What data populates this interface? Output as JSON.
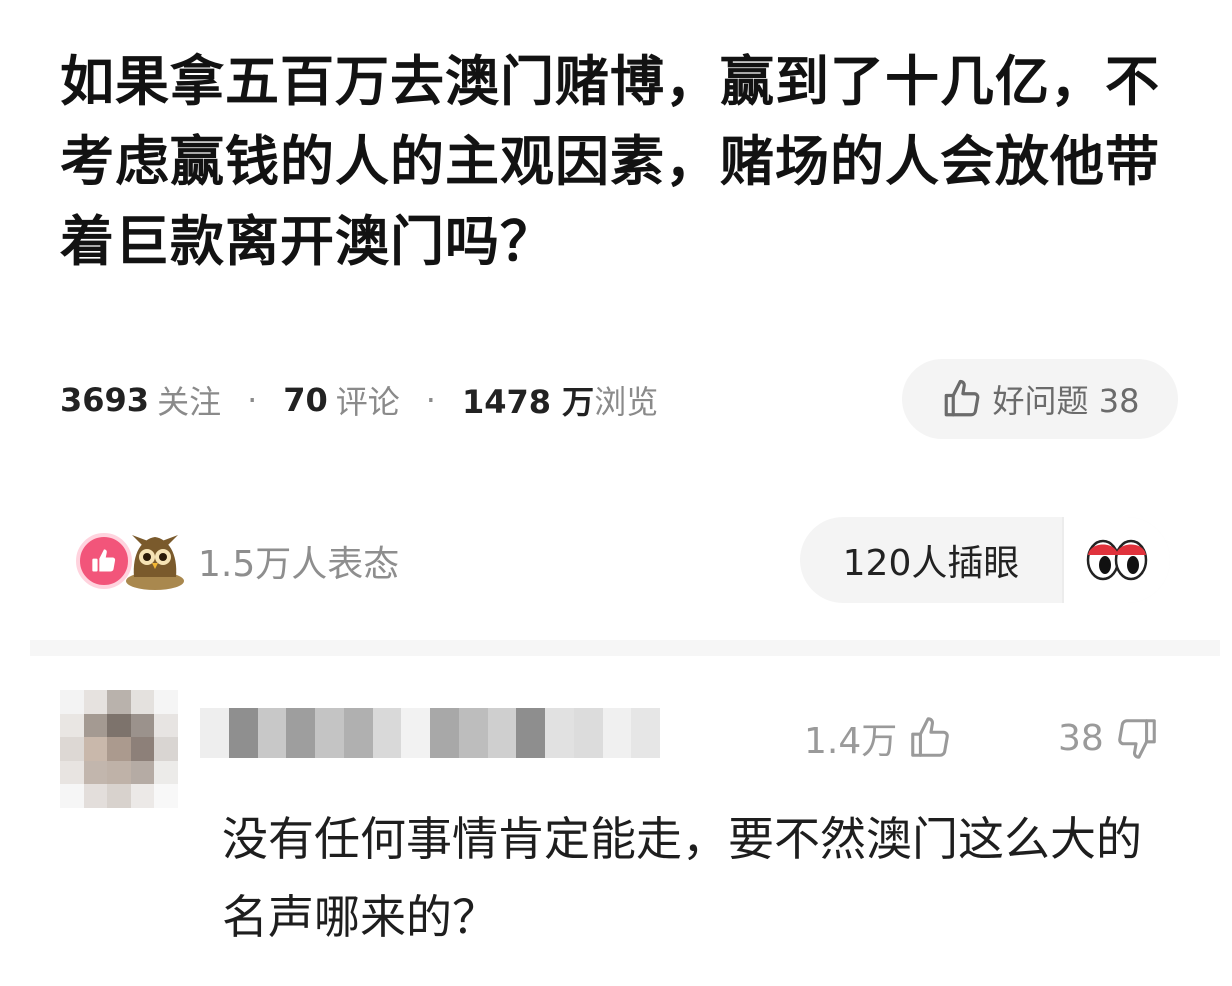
{
  "question": {
    "title": "如果拿五百万去澳门赌博，赢到了十几亿，不考虑赢钱的人的主观因素，赌场的人会放他带着巨款离开澳门吗？"
  },
  "stats": {
    "followers_count": "3693",
    "followers_label": "关注",
    "comments_count": "70",
    "comments_label": "评论",
    "views_count": "1478 万",
    "views_label": "浏览",
    "separator": "·"
  },
  "good_question": {
    "label": "好问题 38",
    "icon": "thumbs-up-outline-icon"
  },
  "reactions": {
    "summary": "1.5万人表态",
    "icons": [
      "like-badge-icon",
      "owl-emoji-icon"
    ],
    "like_color": "#f2557a"
  },
  "eyes_button": {
    "label": "120人插眼",
    "icon": "eyes-emoji-icon"
  },
  "comment": {
    "likes": "1.4万",
    "dislikes": "38",
    "text": "没有任何事情肯定能走，要不然澳门这么大的名声哪来的？"
  }
}
